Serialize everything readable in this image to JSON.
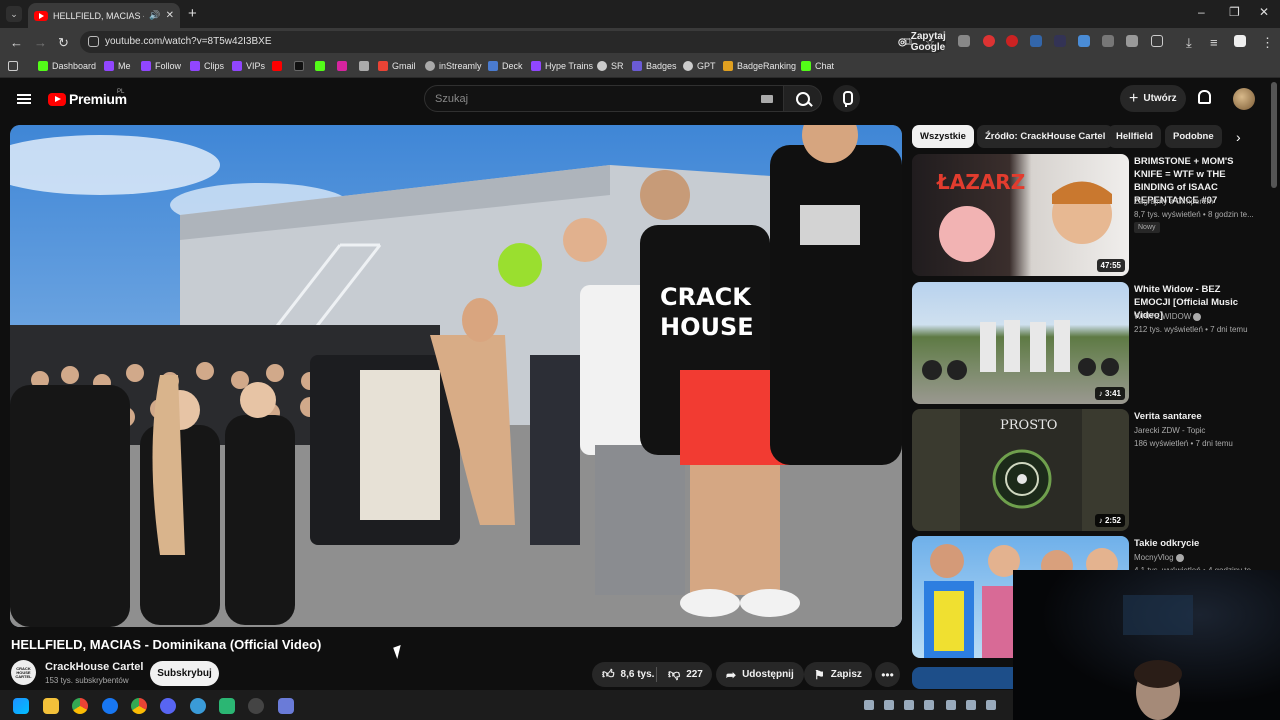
{
  "browser": {
    "tab_title": "HELLFIELD, MACIAS - Domi",
    "url": "youtube.com/watch?v=8T5w42I3BXE",
    "google_button": "Zapytaj Google",
    "bookmarks": [
      "Dashboard",
      "Me",
      "Follow",
      "Clips",
      "VIPs",
      "Gmail",
      "inStreamly",
      "Deck",
      "Hype Trains",
      "SR",
      "Badges",
      "GPT",
      "BadgeRanking",
      "Chat"
    ]
  },
  "youtube": {
    "logo_text": "Premium",
    "logo_region": "PL",
    "search_placeholder": "Szukaj",
    "create_label": "Utwórz"
  },
  "video": {
    "title": "HELLFIELD, MACIAS - Dominikana (Official Video)",
    "channel": "CrackHouse Cartel",
    "channel_avatar_text": "CRACK HOUSE CARTEL",
    "subscribers": "153 tys. subskrybentów",
    "subscribe_label": "Subskrybuj",
    "likes": "8,6 tys.",
    "dislikes": "227",
    "share_label": "Udostępnij",
    "save_label": "Zapisz"
  },
  "chips": [
    "Wszystkie",
    "Źródło: CrackHouse Cartel",
    "Hellfield",
    "Podobne"
  ],
  "recommendations": [
    {
      "title": "BRIMSTONE + MOM'S KNIFE = WTF w THE BINDING of ISAAC REPENTANCE #07",
      "channel": "Zagrajmy z Gimperem",
      "meta": "8,7 tys. wyświetleń • 8 godzin te...",
      "badge": "Nowy",
      "duration": "47:55",
      "thumb_text": "ŁAZARZ"
    },
    {
      "title": "White Widow - BEZ EMOCJI [Official Music Video]",
      "channel": "WHITE WIDOW",
      "meta": "212 tys. wyświetleń • 7 dni temu",
      "duration": "3:41"
    },
    {
      "title": "Verita santaree",
      "channel": "Jarecki ZDW - Topic",
      "meta": "186 wyświetleń • 7 dni temu",
      "duration": "2:52",
      "thumb_text": "PROSTO"
    },
    {
      "title": "Takie odkrycie",
      "channel": "MocnyVlog",
      "meta": "4,1 tys. wyświetleń • 4 godziny te..."
    }
  ]
}
